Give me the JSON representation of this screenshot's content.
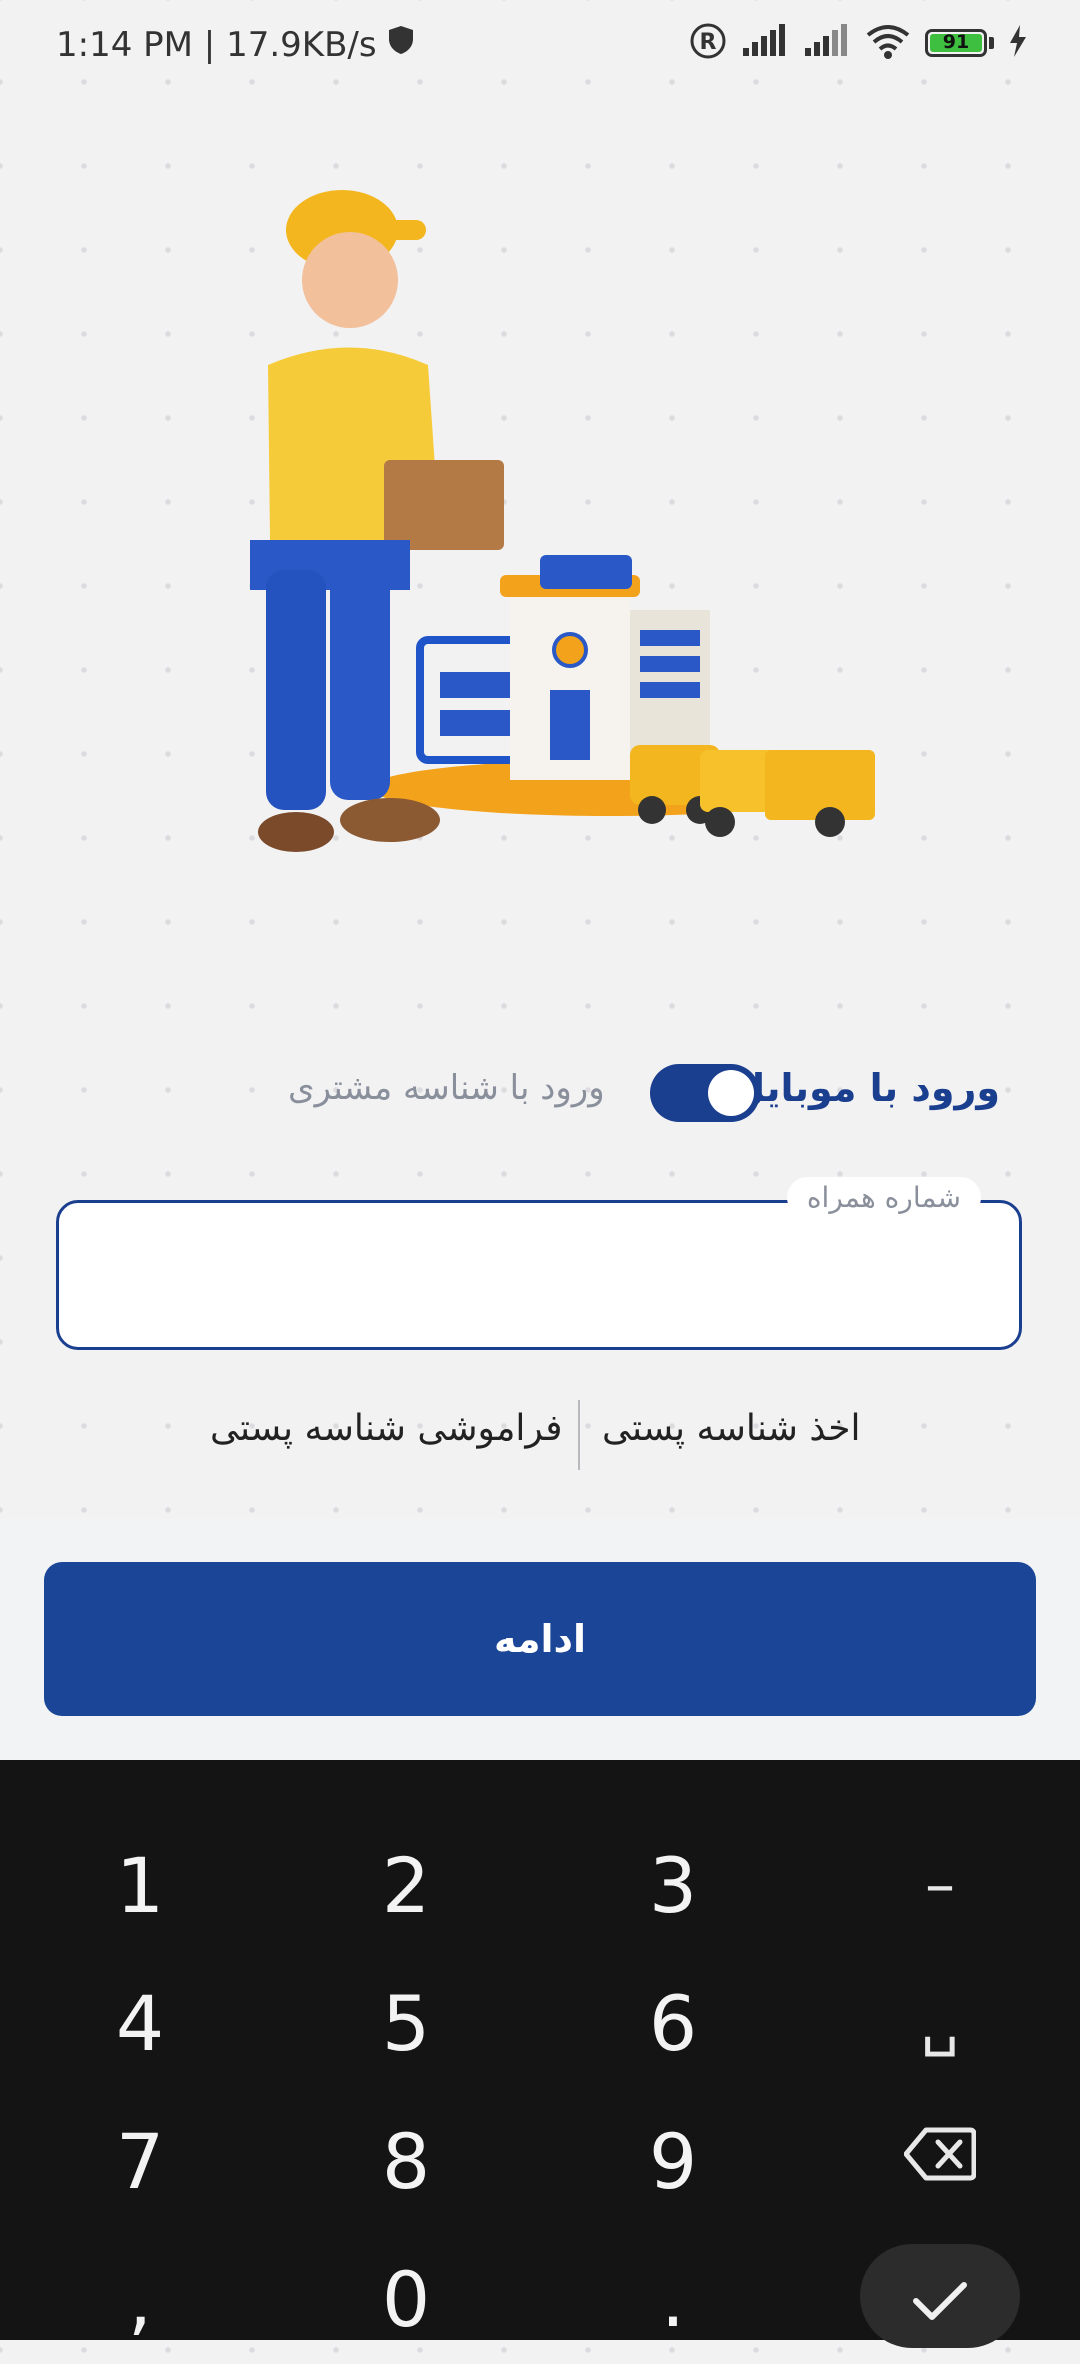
{
  "status_bar": {
    "time": "1:14 PM | 17.9KB/s",
    "battery": "91"
  },
  "login_mode": {
    "mobile_label": "ورود با موبایل",
    "customer_id_label": "ورود با شناسه مشتری",
    "mobile_selected": true
  },
  "phone_field": {
    "label": "شماره همراه",
    "value": ""
  },
  "links": {
    "get_postal_id": "اخذ شناسه پستی",
    "forgot_postal_id": "فراموشی شناسه پستی"
  },
  "continue_button": "ادامه",
  "keyboard": {
    "k1": "1",
    "k2": "2",
    "k3": "3",
    "dash": "–",
    "k4": "4",
    "k5": "5",
    "k6": "6",
    "space": "␣",
    "k7": "7",
    "k8": "8",
    "k9": "9",
    "comma": ",",
    "k0": "0",
    "dot": "."
  },
  "colors": {
    "primary": "#1b4596",
    "background": "#f2f2f3",
    "keyboard": "#141414"
  },
  "icons": [
    "shield-icon",
    "registered-icon",
    "signal-icon",
    "wifi-icon",
    "battery-icon",
    "charging-icon",
    "backspace-icon",
    "check-icon"
  ]
}
